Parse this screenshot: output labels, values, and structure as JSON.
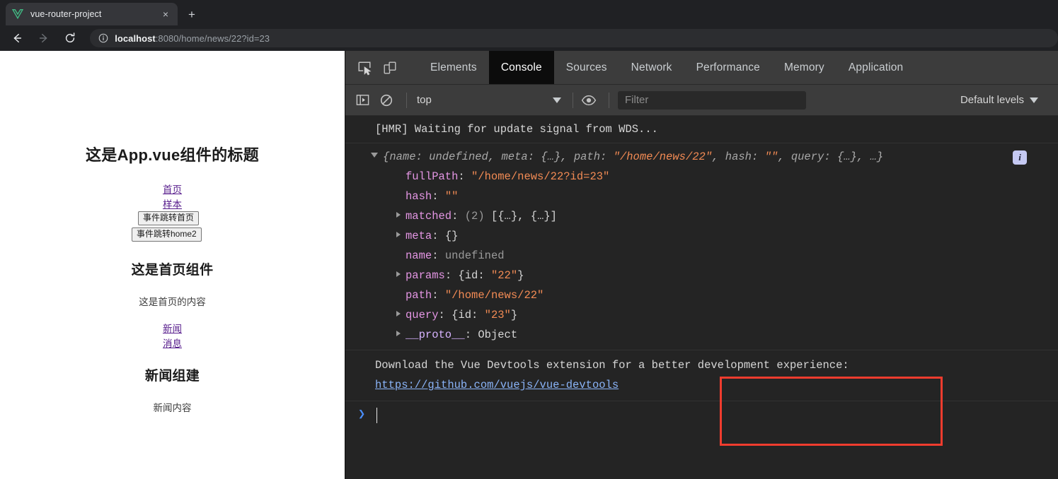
{
  "browser": {
    "tab": {
      "title": "vue-router-project",
      "favicon": "vue-logo-icon",
      "close": "×"
    },
    "new_tab_label": "+",
    "nav": {
      "back": "←",
      "forward": "→",
      "reload": "⟳"
    },
    "omnibox": {
      "info_icon": "info-circle-icon",
      "host": "localhost",
      "rest": ":8080/home/news/22?id=23"
    }
  },
  "page": {
    "app_title": "这是App.vue组件的标题",
    "links_top": [
      "首页",
      "样本"
    ],
    "buttons": [
      "事件跳转首页",
      "事件跳转home2"
    ],
    "home_heading": "这是首页组件",
    "home_content": "这是首页的内容",
    "links_mid": [
      "新闻",
      "消息"
    ],
    "news_heading": "新闻组建",
    "news_content": "新闻内容"
  },
  "devtools": {
    "tool_icons": [
      "inspect-element-icon",
      "device-toolbar-icon"
    ],
    "tabs": [
      {
        "label": "Elements",
        "active": false
      },
      {
        "label": "Console",
        "active": true
      },
      {
        "label": "Sources",
        "active": false
      },
      {
        "label": "Network",
        "active": false
      },
      {
        "label": "Performance",
        "active": false
      },
      {
        "label": "Memory",
        "active": false
      },
      {
        "label": "Application",
        "active": false
      }
    ],
    "filterbar": {
      "sidebar_icon": "console-sidebar-icon",
      "clear_icon": "clear-console-icon",
      "context": "top",
      "eye_icon": "live-expression-icon",
      "filter_placeholder": "Filter",
      "levels": "Default levels",
      "levels_caret": "▼"
    },
    "console": {
      "hmr_message": "[HMR] Waiting for update signal from WDS...",
      "object_preview": {
        "open_brace": "{",
        "parts": [
          {
            "key": "name",
            "sep": ": ",
            "val": "undefined",
            "type": "undef"
          },
          {
            "key": "meta",
            "sep": ": ",
            "val": "{…}",
            "type": "plain"
          },
          {
            "key": "path",
            "sep": ": ",
            "val": "\"/home/news/22\"",
            "type": "str"
          },
          {
            "key": "hash",
            "sep": ": ",
            "val": "\"\"",
            "type": "str"
          },
          {
            "key": "query",
            "sep": ": ",
            "val": "{…}",
            "type": "plain"
          }
        ],
        "ellipsis": ", …",
        "close_brace": "}",
        "info_badge": "i"
      },
      "props": [
        {
          "expandable": false,
          "key": "fullPath",
          "val": "\"/home/news/22?id=23\"",
          "type": "str",
          "highlight": false
        },
        {
          "expandable": false,
          "key": "hash",
          "val": "\"\"",
          "type": "str",
          "highlight": false
        },
        {
          "expandable": true,
          "key": "matched",
          "count": "(2)",
          "val": "[{…}, {…}]",
          "type": "plain",
          "highlight": false
        },
        {
          "expandable": true,
          "key": "meta",
          "val": "{}",
          "type": "plain",
          "highlight": false
        },
        {
          "expandable": false,
          "key": "name",
          "val": "undefined",
          "type": "undef",
          "highlight": false
        },
        {
          "expandable": true,
          "key": "params",
          "val": "{id: \"22\"}",
          "type": "mixed",
          "highlight": true
        },
        {
          "expandable": false,
          "key": "path",
          "val": "\"/home/news/22\"",
          "type": "str",
          "highlight": true
        },
        {
          "expandable": true,
          "key": "query",
          "val": "{id: \"23\"}",
          "type": "mixed",
          "highlight": true
        },
        {
          "expandable": true,
          "key": "__proto__",
          "val": "Object",
          "type": "plain",
          "highlight": false
        }
      ],
      "devtools_notice": "Download the Vue Devtools extension for a better development experience:",
      "devtools_link": "https://github.com/vuejs/vue-devtools",
      "prompt_caret": "❯"
    }
  },
  "colors": {
    "highlight_box": "#f03c2e",
    "accent_blue": "#8ab4f8",
    "devtools_bg": "#242424",
    "toolbar_bg": "#3c3c3c"
  }
}
